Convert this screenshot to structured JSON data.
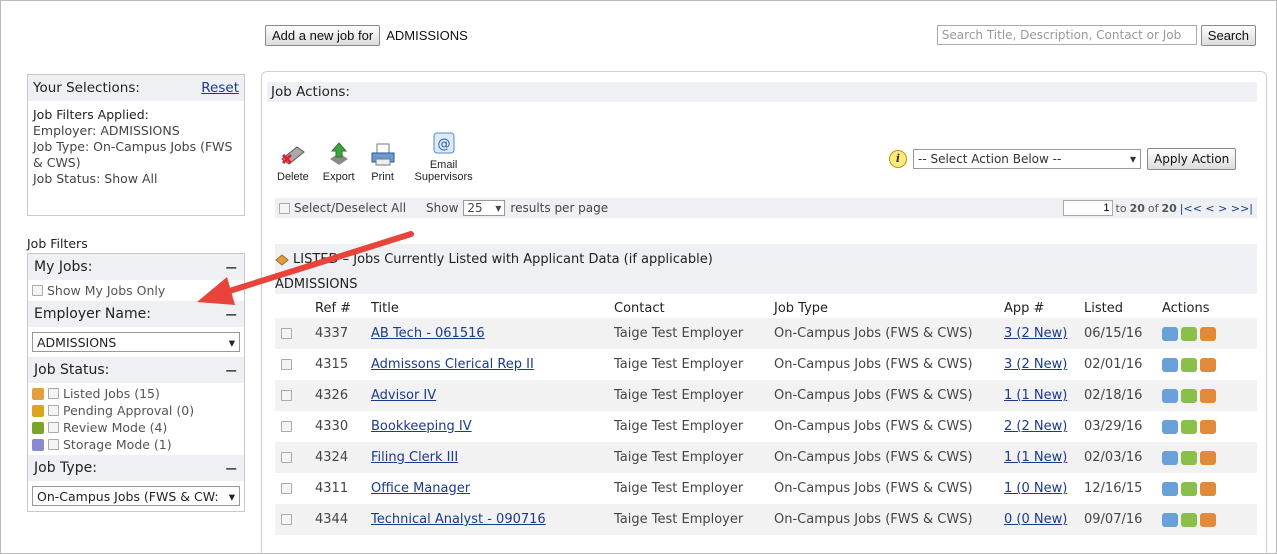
{
  "header": {
    "add_job_label": "Add a new job for",
    "department": "ADMISSIONS",
    "search_placeholder": "Search Title, Description, Contact or Job",
    "search_button": "Search"
  },
  "selections": {
    "title": "Your Selections:",
    "reset": "Reset",
    "applied_title": "Job Filters Applied:",
    "lines": [
      "Employer: ADMISSIONS",
      "Job Type: On-Campus Jobs (FWS & CWS)",
      "Job Status: Show All"
    ]
  },
  "filters": {
    "title": "Job Filters",
    "my_jobs": {
      "label": "My Jobs:",
      "toggle": "−",
      "option": "Show My Jobs Only"
    },
    "employer": {
      "label": "Employer Name:",
      "toggle": "−",
      "value": "ADMISSIONS"
    },
    "status": {
      "label": "Job Status:",
      "toggle": "−",
      "options": [
        {
          "text": "Listed Jobs (15)",
          "icon": "listed-icon",
          "color": "#e0a040"
        },
        {
          "text": "Pending Approval (0)",
          "icon": "pending-icon",
          "color": "#d9a520"
        },
        {
          "text": "Review Mode (4)",
          "icon": "review-icon",
          "color": "#7aa52a"
        },
        {
          "text": "Storage Mode (1)",
          "icon": "storage-icon",
          "color": "#8a8ad0"
        }
      ]
    },
    "job_type": {
      "label": "Job Type:",
      "toggle": "−",
      "value": "On-Campus Jobs (FWS & CW:"
    }
  },
  "actions": {
    "title": "Job Actions:",
    "tools": [
      {
        "label": "Delete",
        "icon": "delete-icon"
      },
      {
        "label": "Export",
        "icon": "export-icon"
      },
      {
        "label": "Print",
        "icon": "print-icon"
      },
      {
        "label": "Email Supervisors",
        "icon": "email-icon"
      }
    ],
    "select_placeholder": "-- Select Action Below --",
    "apply_label": "Apply Action",
    "select_all": "Select/Deselect All",
    "show_label": "Show",
    "per_page": "25",
    "per_page_suffix": "results per page",
    "page_input": "1",
    "range_prefix": "to",
    "range_end": "20",
    "of": "of",
    "total": "20",
    "nav": "|<<  <  >  >>|"
  },
  "listed": {
    "title": "LISTED – Jobs Currently Listed with Applicant Data (if applicable)",
    "department": "ADMISSIONS"
  },
  "table": {
    "headers": [
      "Ref #",
      "Title",
      "Contact",
      "Job Type",
      "App #",
      "Listed",
      "Actions"
    ],
    "rows": [
      {
        "ref": "4337",
        "title": "AB Tech - 061516",
        "contact": "Taige Test Employer",
        "type": "On-Campus Jobs (FWS & CWS)",
        "app": "3 (2 New)",
        "listed": "06/15/16"
      },
      {
        "ref": "4315",
        "title": "Admissons Clerical Rep II",
        "contact": "Taige Test Employer",
        "type": "On-Campus Jobs (FWS & CWS)",
        "app": "3 (2 New)",
        "listed": "02/01/16"
      },
      {
        "ref": "4326",
        "title": "Advisor IV",
        "contact": "Taige Test Employer",
        "type": "On-Campus Jobs (FWS & CWS)",
        "app": "1 (1 New)",
        "listed": "02/18/16"
      },
      {
        "ref": "4330",
        "title": "Bookkeeping IV",
        "contact": "Taige Test Employer",
        "type": "On-Campus Jobs (FWS & CWS)",
        "app": "2 (2 New)",
        "listed": "03/29/16"
      },
      {
        "ref": "4324",
        "title": "Filing Clerk III",
        "contact": "Taige Test Employer",
        "type": "On-Campus Jobs (FWS & CWS)",
        "app": "1 (1 New)",
        "listed": "02/03/16"
      },
      {
        "ref": "4311",
        "title": "Office Manager",
        "contact": "Taige Test Employer",
        "type": "On-Campus Jobs (FWS & CWS)",
        "app": "1 (0 New)",
        "listed": "12/16/15"
      },
      {
        "ref": "4344",
        "title": "Technical Analyst - 090716",
        "contact": "Taige Test Employer",
        "type": "On-Campus Jobs (FWS & CWS)",
        "app": "0 (0 New)",
        "listed": "09/07/16"
      }
    ]
  },
  "colors": {
    "accent": "#1a3a8a",
    "header_bg": "#eef0f4",
    "arrow": "#e8443a"
  }
}
